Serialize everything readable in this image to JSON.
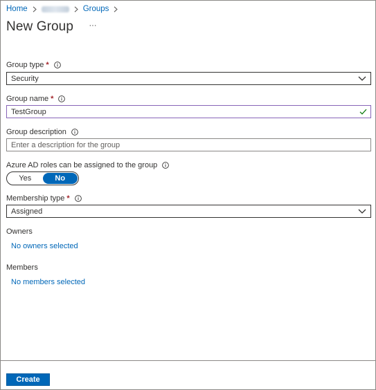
{
  "breadcrumb": {
    "home": "Home",
    "groups": "Groups"
  },
  "page": {
    "title": "New Group",
    "more": "···"
  },
  "form": {
    "group_type": {
      "label": "Group type",
      "required": "*",
      "value": "Security"
    },
    "group_name": {
      "label": "Group name",
      "required": "*",
      "value": "TestGroup"
    },
    "group_description": {
      "label": "Group description",
      "placeholder": "Enter a description for the group"
    },
    "azure_roles": {
      "label": "Azure AD roles can be assigned to the group",
      "options": [
        "Yes",
        "No"
      ],
      "selected": "No"
    },
    "membership_type": {
      "label": "Membership type",
      "required": "*",
      "value": "Assigned"
    },
    "owners": {
      "label": "Owners",
      "link": "No owners selected"
    },
    "members": {
      "label": "Members",
      "link": "No members selected"
    }
  },
  "footer": {
    "create_label": "Create"
  },
  "colors": {
    "accent": "#0067b8",
    "required": "#a4262c",
    "valid_border": "#8764b8",
    "valid_check": "#107c10"
  },
  "icons": [
    "chevron-right-icon",
    "info-icon",
    "chevron-down-icon",
    "checkmark-icon"
  ]
}
